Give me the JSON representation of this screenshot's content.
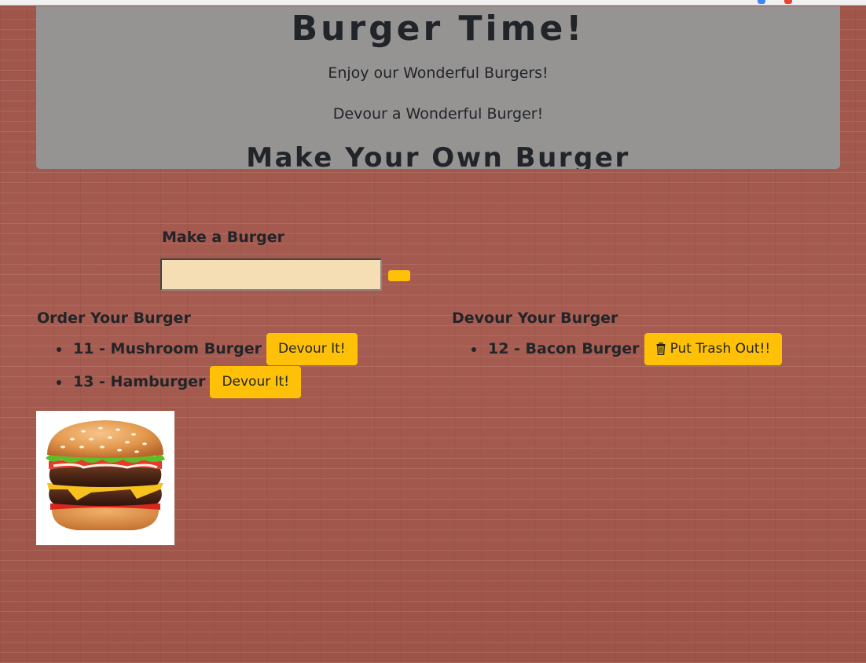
{
  "header": {
    "title": "Burger Time!",
    "tagline1": "Enjoy our Wonderful Burgers!",
    "tagline2": "Devour a Wonderful Burger!",
    "subtitle": "Make Your Own Burger"
  },
  "form": {
    "label": "Make a Burger",
    "input_value": "",
    "submit_label": ""
  },
  "order": {
    "title": "Order Your Burger",
    "items": [
      {
        "text": "11 - Mushroom Burger",
        "button": "Devour It!"
      },
      {
        "text": "13 - Hamburger",
        "button": "Devour It!"
      }
    ]
  },
  "devour": {
    "title": "Devour Your Burger",
    "items": [
      {
        "text": "12 - Bacon Burger",
        "button": "Put Trash Out!!",
        "icon": "trash-icon"
      }
    ]
  },
  "image": {
    "icon": "burger-image"
  },
  "colors": {
    "accent": "#ffc107",
    "input_bg": "#f5deb3",
    "brick": "#a3584c",
    "header_bg": "#969696",
    "text": "#212529"
  }
}
